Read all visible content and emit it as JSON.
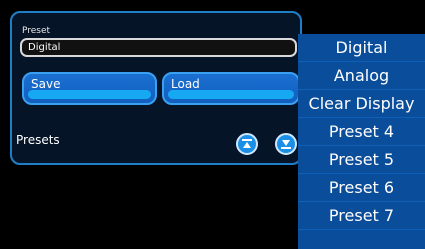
{
  "preset": {
    "label": "Preset",
    "value": "Digital"
  },
  "buttons": {
    "save_label": "Save",
    "load_label": "Load"
  },
  "presets_label": "Presets",
  "icons": {
    "up": "arrow-up-icon",
    "down": "arrow-down-icon"
  },
  "dropdown": {
    "items": [
      "Digital",
      "Analog",
      "Clear Display",
      "Preset 4",
      "Preset 5",
      "Preset 6",
      "Preset 7"
    ]
  },
  "colors": {
    "panel_border": "#1e7fc8",
    "button_blue": "#1a6fd0",
    "dropdown_bg": "#0a4d9a"
  }
}
